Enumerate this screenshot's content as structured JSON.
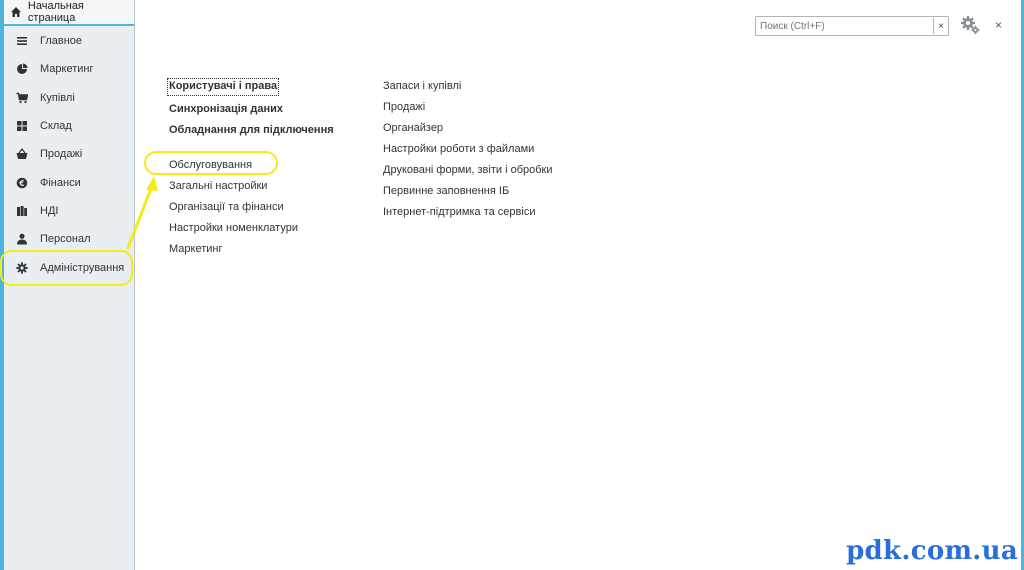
{
  "home_tab": {
    "label": "Начальная страница",
    "icon": "home-icon"
  },
  "sidebar": {
    "items": [
      {
        "label": "Главное",
        "icon": "list-icon"
      },
      {
        "label": "Маркетинг",
        "icon": "pie-chart-icon"
      },
      {
        "label": "Купівлі",
        "icon": "cart-icon"
      },
      {
        "label": "Склад",
        "icon": "grid-icon"
      },
      {
        "label": "Продажі",
        "icon": "basket-icon"
      },
      {
        "label": "Фінанси",
        "icon": "coin-icon"
      },
      {
        "label": "НДІ",
        "icon": "book-icon"
      },
      {
        "label": "Персонал",
        "icon": "person-icon"
      },
      {
        "label": "Адміністрування",
        "icon": "gear-icon"
      }
    ],
    "active_index": 8
  },
  "search": {
    "placeholder": "Поиск (Ctrl+F)",
    "clear_label": "×"
  },
  "close_label": "×",
  "left_column": {
    "bold_links": [
      "Користувачі і права",
      "Синхронізація даних",
      "Обладнання для підключення"
    ],
    "links": [
      "Обслуговування",
      "Загальні настройки",
      "Організації та фінанси",
      "Настройки номенклатури",
      "Маркетинг"
    ]
  },
  "right_column": {
    "links": [
      "Запаси і купівлі",
      "Продажі",
      "Органайзер",
      "Настройки роботи з файлами",
      "Друковані форми, звіти і обробки",
      "Первинне заповнення ІБ",
      "Інтернет-підтримка та сервіси"
    ]
  },
  "watermark": "pdk.com.ua",
  "colors": {
    "accent": "#4fb3dc",
    "highlight": "#f3ec17",
    "watermark": "#2a6fd9",
    "sidebar_bg": "#e8eef2"
  }
}
